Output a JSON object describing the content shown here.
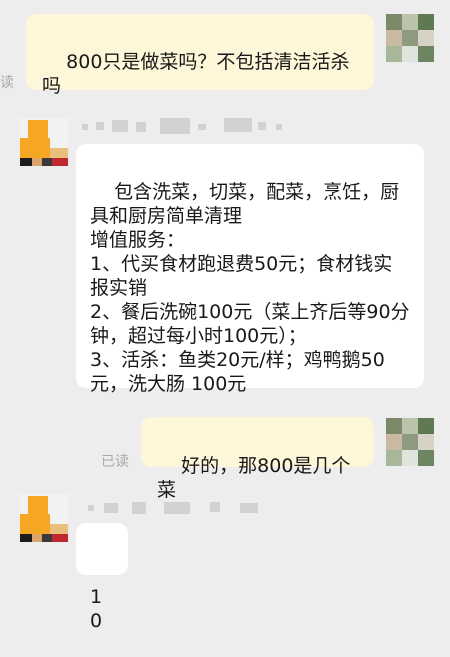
{
  "read_label": "已读",
  "messages": [
    {
      "side": "out",
      "text": "800只是做菜吗？不包括清洁活杀吗",
      "status": ""
    },
    {
      "side": "in",
      "text": "包含洗菜，切菜，配菜，烹饪，厨具和厨房简单清理\n增值服务：\n1、代买食材跑退费50元；食材钱实报实销\n2、餐后洗碗100元（菜上齐后等90分钟，超过每小时100元）；\n3、活杀：鱼类20元/样；鸡鸭鹅50元，洗大肠 100元"
    },
    {
      "side": "out",
      "text": "好的，那800是几个菜",
      "status": "已读"
    },
    {
      "side": "in",
      "text": "10"
    }
  ],
  "colors": {
    "background": "#ededed",
    "incoming_bubble": "#ffffff",
    "outgoing_bubble": "#fdf6d9"
  }
}
